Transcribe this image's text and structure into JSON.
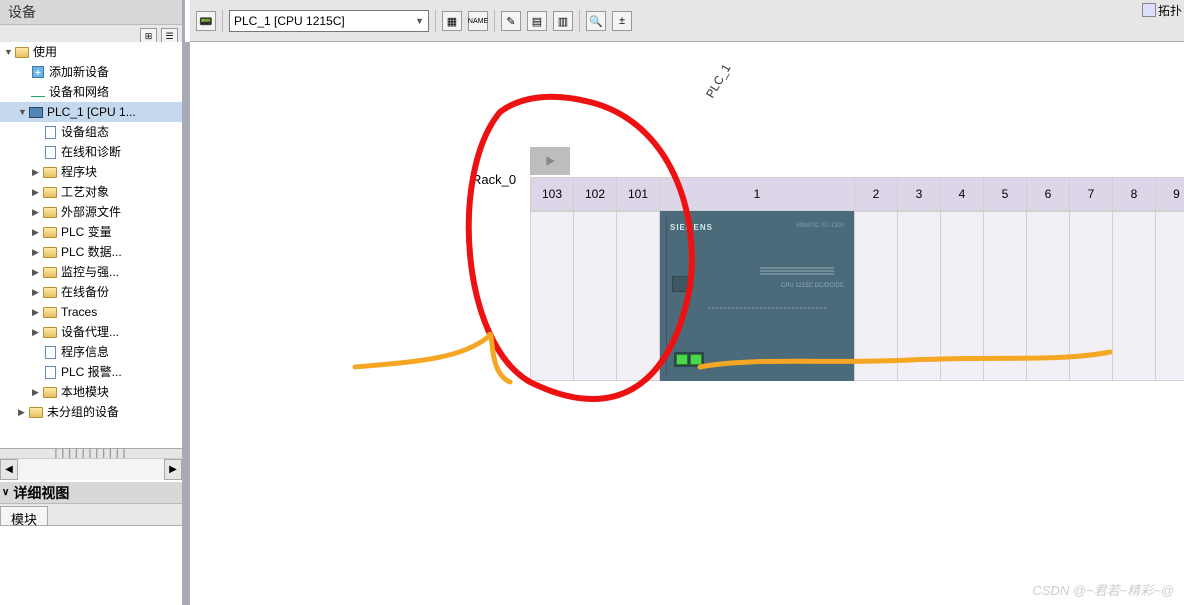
{
  "top": {
    "devices_label": "设备",
    "expand_label": "拓扑"
  },
  "tree": {
    "root": "使用",
    "items": [
      "添加新设备",
      "设备和网络",
      "PLC_1 [CPU 1...",
      "设备组态",
      "在线和诊断",
      "程序块",
      "工艺对象",
      "外部源文件",
      "PLC 变量",
      "PLC 数据...",
      "监控与强...",
      "在线备份",
      "Traces",
      "设备代理...",
      "程序信息",
      "PLC 报警...",
      "本地模块",
      "未分组的设备"
    ]
  },
  "details": {
    "title": "详细视图",
    "tab": "模块"
  },
  "toolbar": {
    "device_selector": "PLC_1 [CPU 1215C]"
  },
  "rack": {
    "name": "PLC_1",
    "label": "Rack_0",
    "slots_left": [
      "103",
      "102",
      "101"
    ],
    "slot_main": "1",
    "slots_right": [
      "2",
      "3",
      "4",
      "5",
      "6",
      "7",
      "8",
      "9"
    ]
  },
  "cpu": {
    "brand": "SIEMENS",
    "type": "SIMATIC S7-1200",
    "model": "CPU 1215C\nDC/DC/DC"
  },
  "watermark": "CSDN @~君若~精彩~@"
}
